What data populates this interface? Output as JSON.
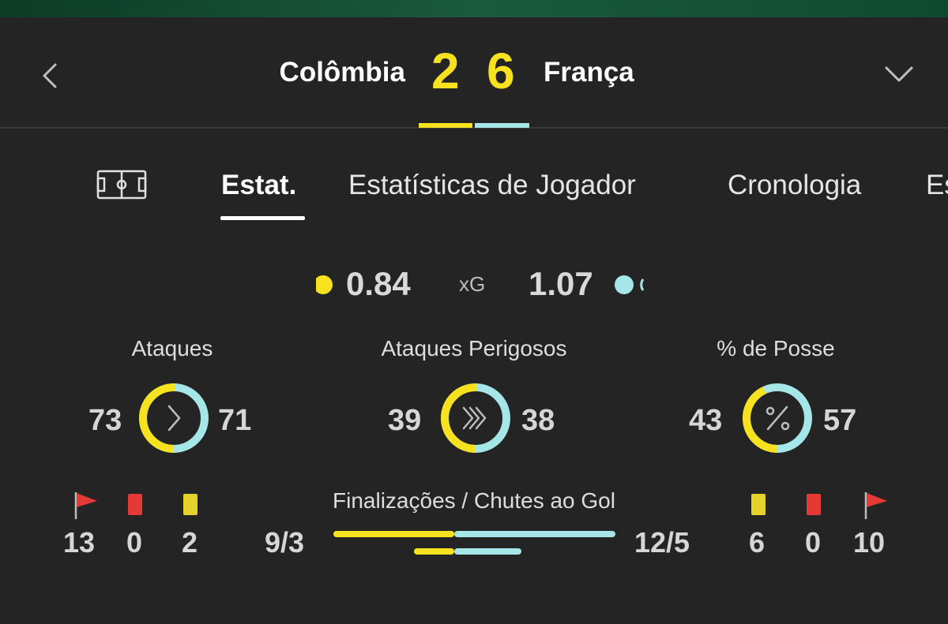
{
  "header": {
    "home_team": "Colômbia",
    "away_team": "França",
    "home_score": "2",
    "away_score": "6"
  },
  "tabs": [
    {
      "label": "Estat.",
      "active": true
    },
    {
      "label": "Estatísticas de Jogador",
      "active": false
    },
    {
      "label": "Cronologia",
      "active": false
    },
    {
      "label": "Es",
      "active": false
    }
  ],
  "xg": {
    "label": "xG",
    "home": "0.84",
    "away": "1.07"
  },
  "stats": {
    "attacks": {
      "title": "Ataques",
      "home": "73",
      "away": "71"
    },
    "dangerous_attacks": {
      "title": "Ataques Perigosos",
      "home": "39",
      "away": "38"
    },
    "possession": {
      "title": "% de Posse",
      "home": "43",
      "away": "57"
    }
  },
  "shots": {
    "title": "Finalizações / Chutes ao Gol",
    "home": "9/3",
    "away": "12/5",
    "home_total": 9,
    "away_total": 12,
    "home_on_target": 3,
    "away_on_target": 5
  },
  "home_counts": {
    "corners": "13",
    "red_cards": "0",
    "yellow_cards": "2"
  },
  "away_counts": {
    "yellow_cards": "6",
    "red_cards": "0",
    "corners": "10"
  },
  "colors": {
    "home": "#f7e21f",
    "away": "#a5e6e8",
    "background": "#242424",
    "red_card": "#e53935",
    "yellow_card": "#e5d22a"
  },
  "icons": {
    "back": "chevron-left-icon",
    "dropdown": "chevron-down-icon",
    "pitch": "pitch-icon",
    "attacks": "chevron-right-icon",
    "dangerous_attacks": "triple-chevron-icon",
    "possession": "percent-icon",
    "corner": "corner-flag-icon"
  }
}
